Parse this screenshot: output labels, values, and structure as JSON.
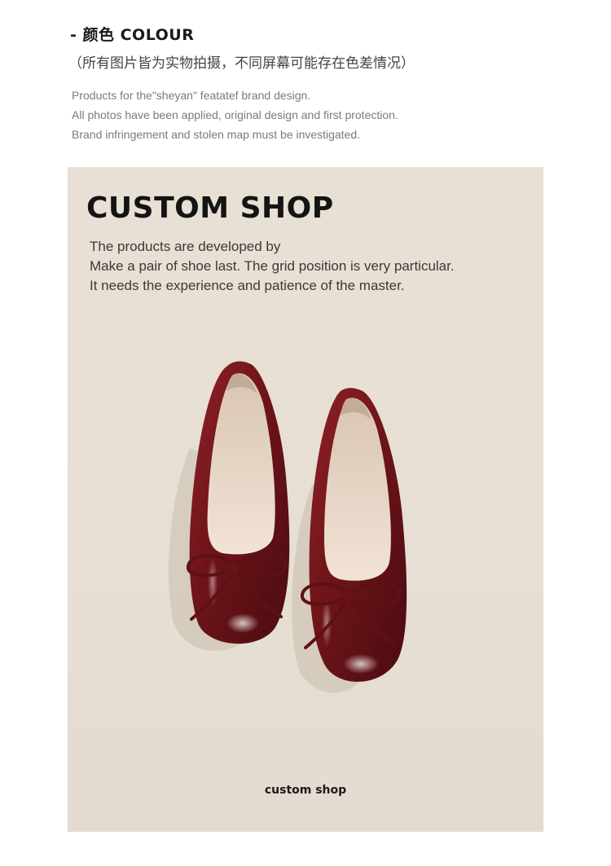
{
  "header": {
    "title": "- 颜色  COLOUR",
    "subtitle": "（所有图片皆为实物拍摄，不同屏幕可能存在色差情况）",
    "notes": [
      "Products for the\"sheyan\" featatef brand design.",
      "All photos have been applied, original design and first protection.",
      "Brand infringement and stolen map must be investigated."
    ]
  },
  "panel": {
    "title": "CUSTOM SHOP",
    "lines": [
      "The products are developed by",
      "Make a pair of shoe last. The grid position is very particular.",
      "It needs the experience and patience of the master."
    ],
    "caption": "custom shop"
  },
  "colors": {
    "background": "#e8e0d4",
    "shoe": "#7a1a1f",
    "insole": "#ecd9c8"
  }
}
